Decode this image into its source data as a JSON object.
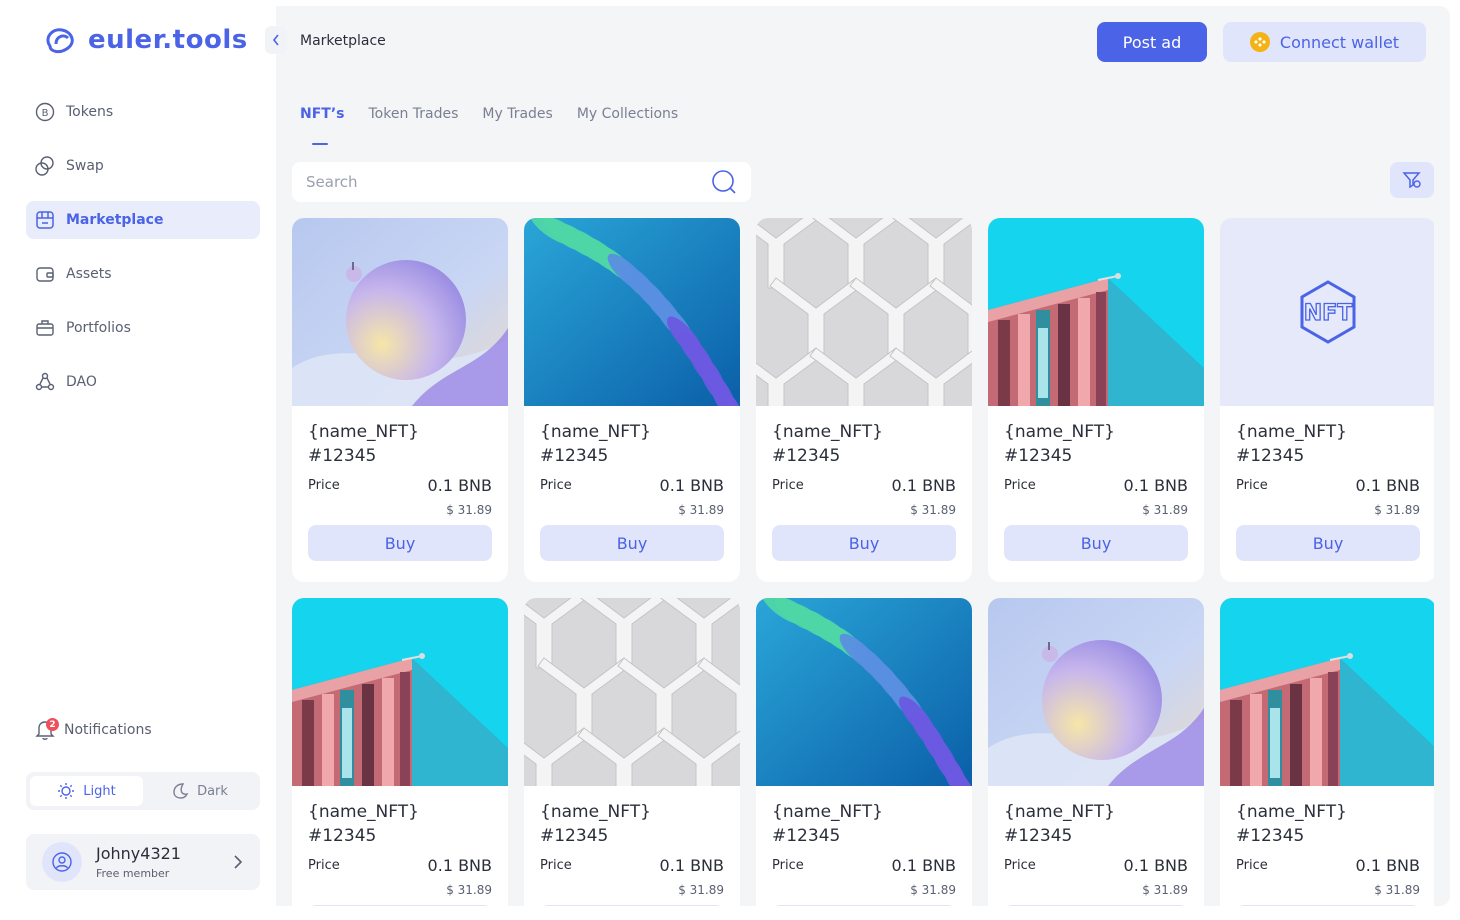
{
  "brand": {
    "name": "euler.tools",
    "color": "#4a63e7"
  },
  "sidebar": {
    "items": [
      {
        "label": "Tokens",
        "icon": "bitcoin-icon"
      },
      {
        "label": "Swap",
        "icon": "swap-icon"
      },
      {
        "label": "Marketplace",
        "icon": "store-icon"
      },
      {
        "label": "Assets",
        "icon": "wallet-icon"
      },
      {
        "label": "Portfolios",
        "icon": "briefcase-icon"
      },
      {
        "label": "DAO",
        "icon": "network-icon"
      }
    ],
    "notifications": {
      "label": "Notifications",
      "count": "2"
    },
    "theme": {
      "light": "Light",
      "dark": "Dark"
    },
    "user": {
      "name": "Johny4321",
      "role": "Free member"
    }
  },
  "header": {
    "title": "Marketplace",
    "post_ad": "Post ad",
    "connect_wallet": "Connect wallet"
  },
  "tabs": [
    "NFT’s",
    "Token Trades",
    "My Trades",
    "My Collections"
  ],
  "search": {
    "placeholder": "Search"
  },
  "card_common": {
    "price_label": "Price",
    "buy_label": "Buy"
  },
  "cards": [
    {
      "name": "{name_NFT}",
      "id": "#12345",
      "price": "0.1 BNB",
      "usd": "$ 31.89",
      "art": "sphere"
    },
    {
      "name": "{name_NFT}",
      "id": "#12345",
      "price": "0.1 BNB",
      "usd": "$ 31.89",
      "art": "wave"
    },
    {
      "name": "{name_NFT}",
      "id": "#12345",
      "price": "0.1 BNB",
      "usd": "$ 31.89",
      "art": "weave"
    },
    {
      "name": "{name_NFT}",
      "id": "#12345",
      "price": "0.1 BNB",
      "usd": "$ 31.89",
      "art": "building"
    },
    {
      "name": "{name_NFT}",
      "id": "#12345",
      "price": "0.1 BNB",
      "usd": "$ 31.89",
      "art": "nft-logo"
    },
    {
      "name": "{name_NFT}",
      "id": "#12345",
      "price": "0.1 BNB",
      "usd": "$ 31.89",
      "art": "building"
    },
    {
      "name": "{name_NFT}",
      "id": "#12345",
      "price": "0.1 BNB",
      "usd": "$ 31.89",
      "art": "weave"
    },
    {
      "name": "{name_NFT}",
      "id": "#12345",
      "price": "0.1 BNB",
      "usd": "$ 31.89",
      "art": "wave"
    },
    {
      "name": "{name_NFT}",
      "id": "#12345",
      "price": "0.1 BNB",
      "usd": "$ 31.89",
      "art": "sphere"
    },
    {
      "name": "{name_NFT}",
      "id": "#12345",
      "price": "0.1 BNB",
      "usd": "$ 31.89",
      "art": "building"
    }
  ]
}
